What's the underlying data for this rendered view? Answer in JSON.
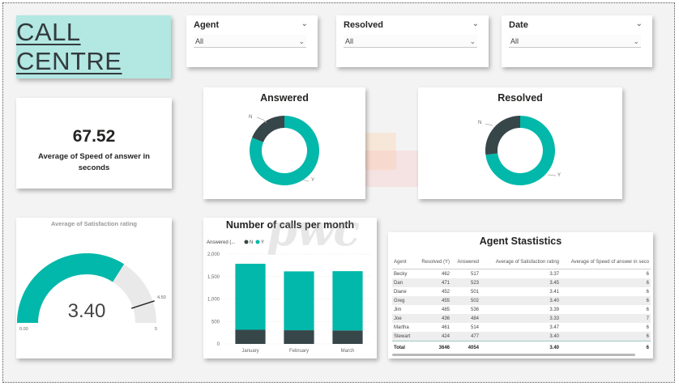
{
  "header": {
    "title": "CALL CENTRE"
  },
  "slicers": [
    {
      "label": "Agent",
      "value": "All"
    },
    {
      "label": "Resolved",
      "value": "All"
    },
    {
      "label": "Date",
      "value": "All"
    }
  ],
  "kpi": {
    "value": "67.52",
    "label": "Average of Speed of answer in seconds"
  },
  "colors": {
    "teal": "#01b8aa",
    "dark": "#374649",
    "gauge_bg": "#e9e9e9",
    "title_bg": "#b2e7e2"
  },
  "donuts": [
    {
      "title": "Answered",
      "slices": [
        {
          "name": "N",
          "value": 0.19
        },
        {
          "name": "Y",
          "value": 0.81
        }
      ]
    },
    {
      "title": "Resolved",
      "slices": [
        {
          "name": "N",
          "value": 0.27
        },
        {
          "name": "Y",
          "value": 0.73
        }
      ]
    }
  ],
  "gauge": {
    "title": "Average of Satisfaction rating",
    "value": 3.4,
    "value_label": "3.40",
    "min": 0,
    "min_label": "0.00",
    "max": 5,
    "max_label": "5",
    "target": 4.5,
    "target_label": "4.50"
  },
  "chart_data": {
    "type": "bar",
    "title": "Number of calls per month",
    "legend_title": "Answered (...",
    "categories": [
      "January",
      "February",
      "March"
    ],
    "series": [
      {
        "name": "N",
        "values": [
          315,
          305,
          300
        ]
      },
      {
        "name": "Y",
        "values": [
          1470,
          1310,
          1320
        ]
      }
    ],
    "yticks": [
      "0",
      "500",
      "1,000",
      "1,500",
      "2,000"
    ],
    "ylim": [
      0,
      2000
    ],
    "stacked": true
  },
  "agent_table": {
    "title": "Agent Stastistics",
    "columns": [
      "Agent",
      "Resolved (Y)",
      "Answered",
      "Average of Satisfaction rating",
      "Average of Speed of answer in seco"
    ],
    "rows": [
      [
        "Becky",
        "462",
        "517",
        "3.37",
        "6"
      ],
      [
        "Dan",
        "471",
        "523",
        "3.45",
        "6"
      ],
      [
        "Diane",
        "452",
        "501",
        "3.41",
        "6"
      ],
      [
        "Greg",
        "455",
        "502",
        "3.40",
        "6"
      ],
      [
        "Jim",
        "485",
        "536",
        "3.39",
        "6"
      ],
      [
        "Joe",
        "436",
        "484",
        "3.33",
        "7"
      ],
      [
        "Martha",
        "461",
        "514",
        "3.47",
        "6"
      ],
      [
        "Stewart",
        "424",
        "477",
        "3.40",
        "6"
      ]
    ],
    "total": [
      "Total",
      "3646",
      "4054",
      "3.40",
      "6"
    ]
  }
}
